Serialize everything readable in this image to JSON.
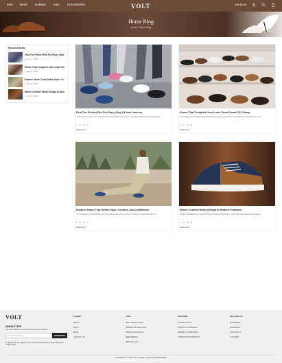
{
  "header": {
    "nav": [
      "NEW",
      "MENS",
      "WOMENS",
      "KIDS",
      "ACCESSORIES"
    ],
    "logo": "VOLT",
    "right_text": "USD $ | US"
  },
  "hero": {
    "title": "Home Blog",
    "breadcrumb": "Home / Home Blog"
  },
  "sidebar": {
    "heading": "Recent Articles",
    "items": [
      {
        "title": "Find The Perfect Pair For Every Step",
        "date": "Jan 17, 2026"
      },
      {
        "title": "Shoes That Complete Your Look, Fro",
        "date": "Jan 17, 2026"
      },
      {
        "title": "Explore Shoes That Define Style, Co",
        "date": "Jan 17, 2026"
      },
      {
        "title": "Where Comfort Meets Design In Mod",
        "date": "Jan 17, 2026"
      }
    ]
  },
  "posts": [
    {
      "title": "Find The Perfect Pair For Every Step Of Your Journey.",
      "excerpt": "Your footwear journey is more than just a shopping experience—it's about discovering shoes that a...",
      "more": "Read more"
    },
    {
      "title": "Shoes That Complete Your Look, From Casual To Classy.",
      "excerpt": "Your shoes are the finishing touch that can elevate any outfit from ordinary to extraordinary. Wh...",
      "more": "Read more"
    },
    {
      "title": "Explore Shoes That Define Style, Comfort, And Confidence.",
      "excerpt": "Your shoes are the finishing touch that can elevate any outfit from ordinary to extraordinary. Th...",
      "more": "Read more"
    },
    {
      "title": "Where Comfort Meets Design In Modern Footwear.",
      "excerpt": "Modern footwear has moved far beyond basic functionality to represent the beautiful intersectio...",
      "more": "Read more"
    }
  ],
  "footer": {
    "logo": "VOLT",
    "newsletter_heading": "NEWSLETTER",
    "newsletter_text": "Get notified about new product launches and updates.",
    "email_placeholder": "Your email address",
    "subscribe_label": "SUBSCRIBE",
    "consent_text": "By Signing Up, You Agree To Our Terms And Conditions, Privacy Policy, And Cookie Policy.",
    "columns": [
      {
        "heading": "LEARN",
        "links": [
          "ABOUT",
          "FAQS",
          "BLOG",
          "CONTACT US"
        ]
      },
      {
        "heading": "VOLT",
        "links": [
          "MEN COLLECTIONS",
          "WOMEN COLLECTIONS",
          "KIDS COLLECTIONS",
          "NEW ARRIVAL",
          "BEST SELLER"
        ]
      },
      {
        "heading": "POLICIES",
        "links": [
          "COOKIE POLICY",
          "PRIVACY STATEMENT",
          "TERMS & CONDITIONS",
          "SHIPPING INFORMATION"
        ]
      },
      {
        "heading": "FOLLOW US",
        "links": [
          "INSTAGRAM",
          "FACEBOOK",
          "TWITTER / X",
          "YOUTUBE"
        ]
      }
    ],
    "copyright": "COPYRIGHT © 2026 VOLT STORE. ALL RIGHTS RESERVED"
  },
  "colors": {
    "brand": "#6b4a37",
    "footer_bg": "#f0f0f0"
  }
}
